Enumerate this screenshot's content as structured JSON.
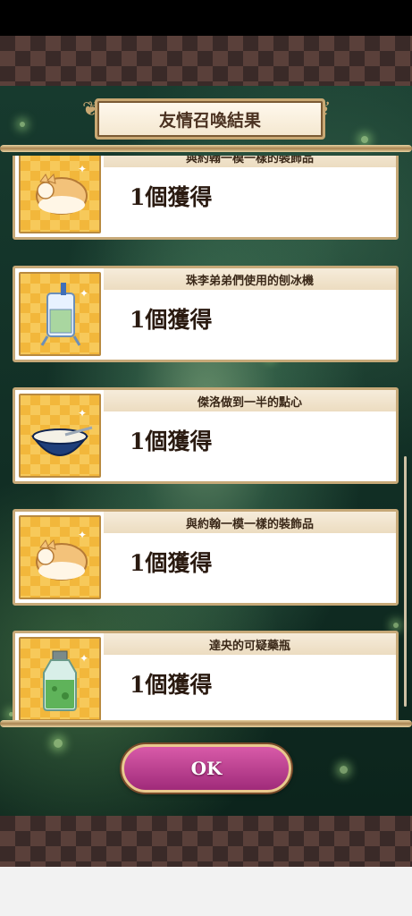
{
  "dialog": {
    "title": "友情召喚結果",
    "ok_label": "OK"
  },
  "results": [
    {
      "name": "與約翰一模一樣的裝飾品",
      "count": "1個獲得",
      "icon": "cat-plush-icon"
    },
    {
      "name": "珠李弟弟們使用的刨冰機",
      "count": "1個獲得",
      "icon": "shaved-ice-machine-icon"
    },
    {
      "name": "傑洛做到一半的點心",
      "count": "1個獲得",
      "icon": "mixing-bowl-icon"
    },
    {
      "name": "與約翰一模一樣的裝飾品",
      "count": "1個獲得",
      "icon": "cat-plush-icon"
    },
    {
      "name": "達央的可疑藥瓶",
      "count": "1個獲得",
      "icon": "potion-bottle-icon"
    }
  ],
  "colors": {
    "accent": "#c9a873",
    "ok_button": "#c0448f",
    "icon_bg": "#f7c95a"
  }
}
